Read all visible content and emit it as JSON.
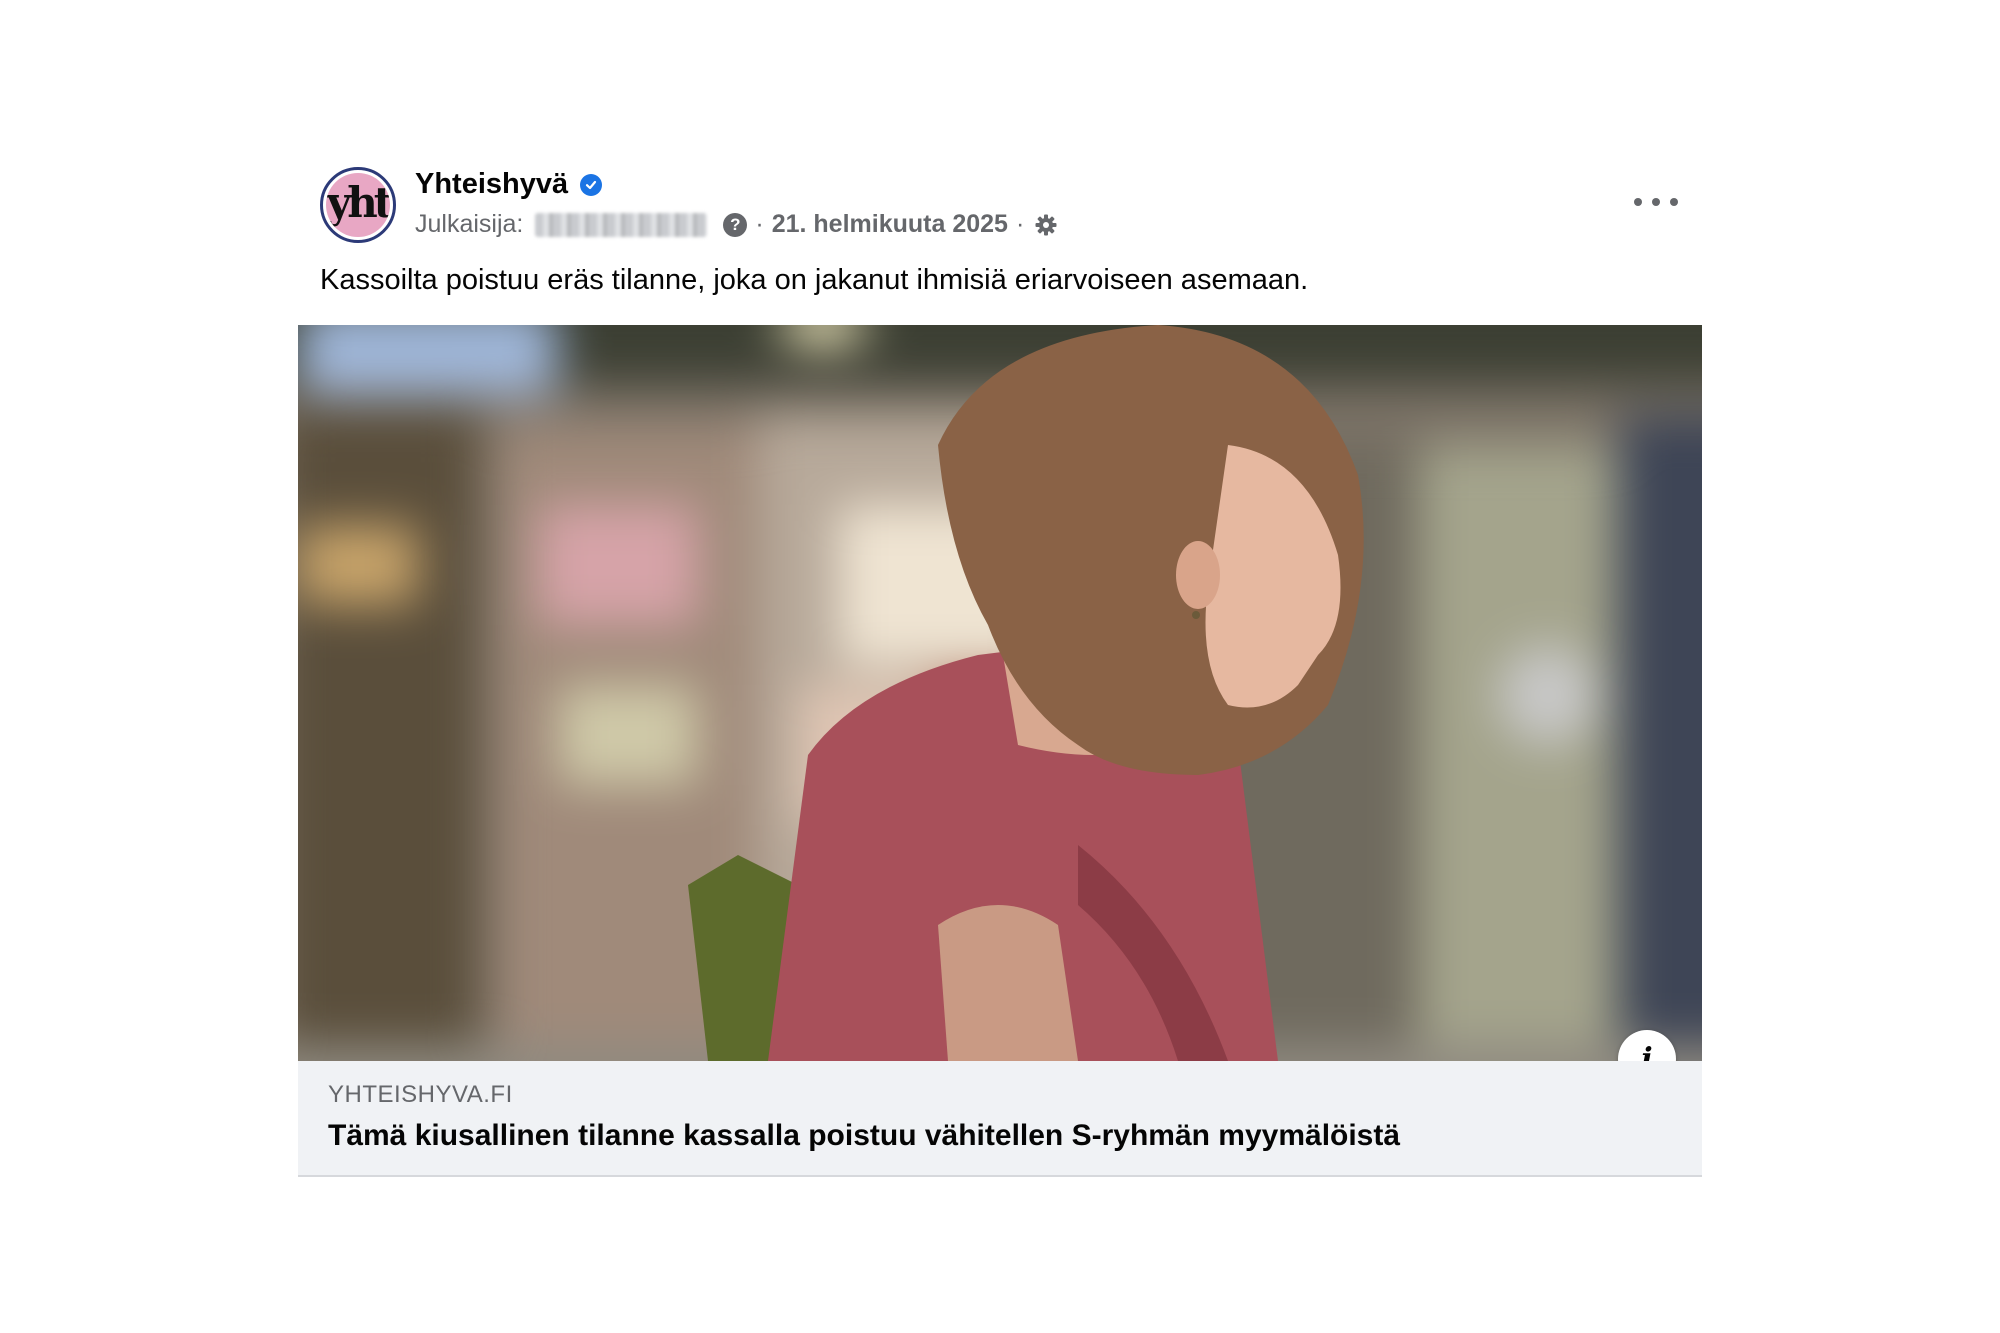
{
  "post": {
    "page_name": "Yhteishyvä",
    "avatar_text": "yht",
    "publisher_label": "Julkaisija:",
    "date": "21. helmikuuta 2025",
    "separator": "·",
    "help_glyph": "?",
    "caption": "Kassoilta poistuu eräs tilanne, joka on jakanut ihmisiä eriarvoiseen asemaan."
  },
  "link_preview": {
    "domain": "YHTEISHYVA.FI",
    "headline": "Tämä kiusallinen tilanne kassalla poistuu vähitellen S-ryhmän myymälöistä",
    "info_glyph": "i"
  },
  "icons": {
    "verified": "verified-badge-icon",
    "help": "question-circle-icon",
    "audience": "gear-icon",
    "more": "more-options-icon",
    "info": "info-icon"
  },
  "colors": {
    "verified_blue": "#1b74e4",
    "avatar_pink": "#e8a7c4",
    "avatar_ring": "#2c3a78",
    "secondary_text": "#65676b",
    "link_box_bg": "#f0f2f5"
  }
}
